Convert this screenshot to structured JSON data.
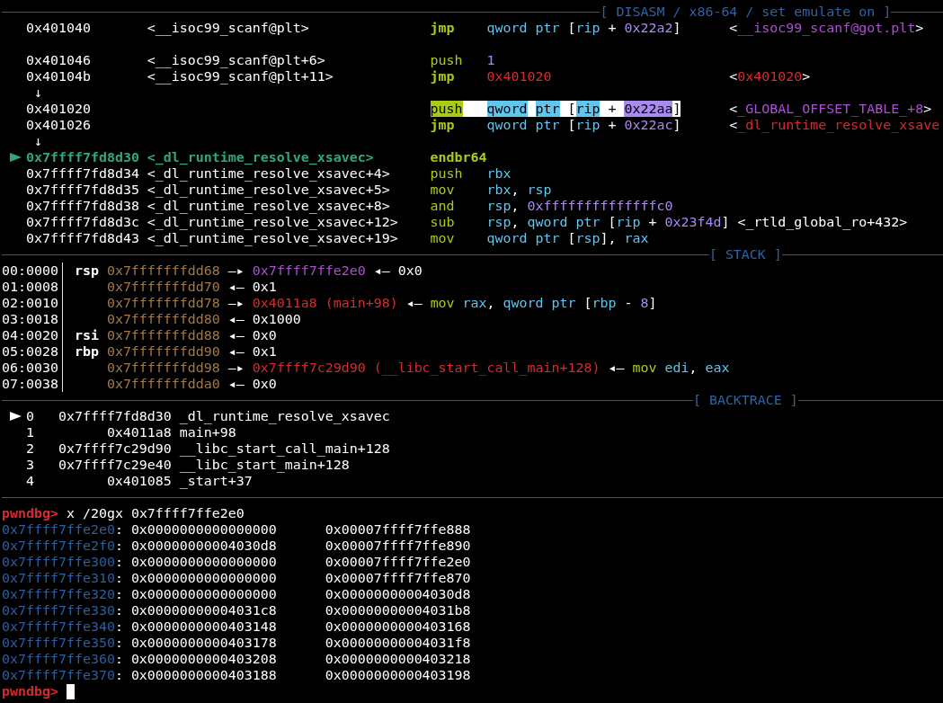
{
  "disasm": {
    "title": "[ DISASM / x86-64 / set emulate on ]",
    "rows": [
      {
        "kind": "instruction",
        "current": false,
        "highlighted": false,
        "branch": true,
        "address": "0x401040",
        "symbol": "<__isoc99_scanf@plt>",
        "mnemonic": "jmp",
        "operands": [
          {
            "text": "qword ptr",
            "kind": "keyword"
          },
          {
            "text": " [",
            "kind": "plain"
          },
          {
            "text": "rip",
            "kind": "register"
          },
          {
            "text": " + ",
            "kind": "plain"
          },
          {
            "text": "0x22a2",
            "kind": "imm"
          },
          {
            "text": "]",
            "kind": "plain"
          }
        ],
        "comment": [
          {
            "text": "<",
            "kind": "plain"
          },
          {
            "text": "__isoc99_scanf@got.plt",
            "kind": "data"
          },
          {
            "text": ">",
            "kind": "plain"
          }
        ]
      },
      {
        "kind": "blank"
      },
      {
        "kind": "instruction",
        "current": false,
        "highlighted": false,
        "branch": false,
        "address": "0x401046",
        "symbol": "<__isoc99_scanf@plt+6>",
        "mnemonic": "push",
        "operands": [
          {
            "text": "1",
            "kind": "imm"
          }
        ]
      },
      {
        "kind": "instruction",
        "current": false,
        "highlighted": false,
        "branch": true,
        "address": "0x40104b",
        "symbol": "<__isoc99_scanf@plt+11>",
        "mnemonic": "jmp",
        "operands": [
          {
            "text": "0x401020",
            "kind": "code"
          }
        ],
        "comment": [
          {
            "text": "<",
            "kind": "plain"
          },
          {
            "text": "0x401020",
            "kind": "code"
          },
          {
            "text": ">",
            "kind": "plain"
          }
        ]
      },
      {
        "kind": "jump",
        "arrow": "↓"
      },
      {
        "kind": "instruction",
        "current": false,
        "highlighted": true,
        "branch": false,
        "address": "0x401020",
        "mnemonic": "push",
        "operands": [
          {
            "text": "qword ptr",
            "kind": "keyword"
          },
          {
            "text": " [",
            "kind": "plain"
          },
          {
            "text": "rip",
            "kind": "register"
          },
          {
            "text": " + ",
            "kind": "plain"
          },
          {
            "text": "0x22aa",
            "kind": "imm"
          },
          {
            "text": "]",
            "kind": "plain"
          }
        ],
        "comment": [
          {
            "text": "<",
            "kind": "plain"
          },
          {
            "text": "_GLOBAL_OFFSET_TABLE_+8",
            "kind": "data"
          },
          {
            "text": ">",
            "kind": "plain"
          }
        ]
      },
      {
        "kind": "instruction",
        "current": false,
        "highlighted": false,
        "branch": true,
        "address": "0x401026",
        "mnemonic": "jmp",
        "operands": [
          {
            "text": "qword ptr",
            "kind": "keyword"
          },
          {
            "text": " [",
            "kind": "plain"
          },
          {
            "text": "rip",
            "kind": "register"
          },
          {
            "text": " + ",
            "kind": "plain"
          },
          {
            "text": "0x22ac",
            "kind": "imm"
          },
          {
            "text": "]",
            "kind": "plain"
          }
        ],
        "comment": [
          {
            "text": "<",
            "kind": "plain"
          },
          {
            "text": "_dl_runtime_resolve_xsave",
            "kind": "code"
          }
        ]
      },
      {
        "kind": "jump",
        "arrow": "↓"
      },
      {
        "kind": "instruction",
        "current": true,
        "highlighted": false,
        "branch": false,
        "address": "0x7ffff7fd8d30",
        "symbol": "<_dl_runtime_resolve_xsavec>",
        "mnemonic": "endbr64"
      },
      {
        "kind": "instruction",
        "current": false,
        "highlighted": false,
        "branch": false,
        "address": "0x7ffff7fd8d34",
        "symbol": "<_dl_runtime_resolve_xsavec+4>",
        "mnemonic": "push",
        "operands": [
          {
            "text": "rbx",
            "kind": "register"
          }
        ]
      },
      {
        "kind": "instruction",
        "current": false,
        "highlighted": false,
        "branch": false,
        "address": "0x7ffff7fd8d35",
        "symbol": "<_dl_runtime_resolve_xsavec+5>",
        "mnemonic": "mov",
        "operands": [
          {
            "text": "rbx",
            "kind": "register"
          },
          {
            "text": ", ",
            "kind": "plain"
          },
          {
            "text": "rsp",
            "kind": "register"
          }
        ]
      },
      {
        "kind": "instruction",
        "current": false,
        "highlighted": false,
        "branch": false,
        "address": "0x7ffff7fd8d38",
        "symbol": "<_dl_runtime_resolve_xsavec+8>",
        "mnemonic": "and",
        "operands": [
          {
            "text": "rsp",
            "kind": "register"
          },
          {
            "text": ", ",
            "kind": "plain"
          },
          {
            "text": "0xffffffffffffffc0",
            "kind": "imm"
          }
        ]
      },
      {
        "kind": "instruction",
        "current": false,
        "highlighted": false,
        "branch": false,
        "address": "0x7ffff7fd8d3c",
        "symbol": "<_dl_runtime_resolve_xsavec+12>",
        "mnemonic": "sub",
        "operands": [
          {
            "text": "rsp",
            "kind": "register"
          },
          {
            "text": ", ",
            "kind": "plain"
          },
          {
            "text": "qword ptr",
            "kind": "keyword"
          },
          {
            "text": " [",
            "kind": "plain"
          },
          {
            "text": "rip",
            "kind": "register"
          },
          {
            "text": " + ",
            "kind": "plain"
          },
          {
            "text": "0x23f4d",
            "kind": "imm"
          },
          {
            "text": "]",
            "kind": "plain"
          }
        ],
        "comment": [
          {
            "text": "<_rtld_global_ro+432>",
            "kind": "plain"
          }
        ]
      },
      {
        "kind": "instruction",
        "current": false,
        "highlighted": false,
        "branch": false,
        "address": "0x7ffff7fd8d43",
        "symbol": "<_dl_runtime_resolve_xsavec+19>",
        "mnemonic": "mov",
        "operands": [
          {
            "text": "qword ptr",
            "kind": "keyword"
          },
          {
            "text": " [",
            "kind": "plain"
          },
          {
            "text": "rsp",
            "kind": "register"
          },
          {
            "text": "], ",
            "kind": "plain"
          },
          {
            "text": "rax",
            "kind": "register"
          }
        ]
      }
    ]
  },
  "stack": {
    "title": "[ STACK ]",
    "rows": [
      {
        "offset": "00:0000",
        "register": "rsp",
        "address": "0x7fffffffdd68",
        "chain": [
          {
            "kind": "arrow",
            "text": "—▸"
          },
          {
            "kind": "data",
            "text": "0x7ffff7ffe2e0"
          },
          {
            "kind": "arrow",
            "text": "◂—"
          },
          {
            "kind": "plain",
            "text": "0x0"
          }
        ]
      },
      {
        "offset": "01:0008",
        "address": "0x7fffffffdd70",
        "chain": [
          {
            "kind": "arrow",
            "text": "◂—"
          },
          {
            "kind": "plain",
            "text": "0x1"
          }
        ]
      },
      {
        "offset": "02:0010",
        "address": "0x7fffffffdd78",
        "chain": [
          {
            "kind": "arrow",
            "text": "—▸"
          },
          {
            "kind": "code",
            "text": "0x4011a8 (main+98)"
          },
          {
            "kind": "arrow",
            "text": "◂—"
          },
          {
            "kind": "instruction",
            "mnemonic": "mov",
            "operands": [
              {
                "text": "rax",
                "kind": "register"
              },
              {
                "text": ", ",
                "kind": "plain"
              },
              {
                "text": "qword ptr",
                "kind": "keyword"
              },
              {
                "text": " [",
                "kind": "plain"
              },
              {
                "text": "rbp",
                "kind": "register"
              },
              {
                "text": " - ",
                "kind": "plain"
              },
              {
                "text": "8",
                "kind": "imm"
              },
              {
                "text": "]",
                "kind": "plain"
              }
            ]
          }
        ]
      },
      {
        "offset": "03:0018",
        "address": "0x7fffffffdd80",
        "chain": [
          {
            "kind": "arrow",
            "text": "◂—"
          },
          {
            "kind": "plain",
            "text": "0x1000"
          }
        ]
      },
      {
        "offset": "04:0020",
        "register": "rsi",
        "address": "0x7fffffffdd88",
        "chain": [
          {
            "kind": "arrow",
            "text": "◂—"
          },
          {
            "kind": "plain",
            "text": "0x0"
          }
        ]
      },
      {
        "offset": "05:0028",
        "register": "rbp",
        "address": "0x7fffffffdd90",
        "chain": [
          {
            "kind": "arrow",
            "text": "◂—"
          },
          {
            "kind": "plain",
            "text": "0x1"
          }
        ]
      },
      {
        "offset": "06:0030",
        "address": "0x7fffffffdd98",
        "chain": [
          {
            "kind": "arrow",
            "text": "—▸"
          },
          {
            "kind": "code",
            "text": "0x7ffff7c29d90 (__libc_start_call_main+128)"
          },
          {
            "kind": "arrow",
            "text": "◂—"
          },
          {
            "kind": "instruction",
            "mnemonic": "mov",
            "operands": [
              {
                "text": "edi",
                "kind": "register"
              },
              {
                "text": ", ",
                "kind": "plain"
              },
              {
                "text": "eax",
                "kind": "register"
              }
            ]
          }
        ]
      },
      {
        "offset": "07:0038",
        "address": "0x7fffffffdda0",
        "chain": [
          {
            "kind": "arrow",
            "text": "◂—"
          },
          {
            "kind": "plain",
            "text": "0x0"
          }
        ]
      }
    ]
  },
  "backtrace": {
    "title": "[ BACKTRACE ]",
    "frames": [
      {
        "current": true,
        "index": "0",
        "address": "0x7ffff7fd8d30",
        "function": "_dl_runtime_resolve_xsavec"
      },
      {
        "current": false,
        "index": "1",
        "address": "0x4011a8",
        "function": "main+98"
      },
      {
        "current": false,
        "index": "2",
        "address": "0x7ffff7c29d90",
        "function": "__libc_start_call_main+128"
      },
      {
        "current": false,
        "index": "3",
        "address": "0x7ffff7c29e40",
        "function": "__libc_start_main+128"
      },
      {
        "current": false,
        "index": "4",
        "address": "0x401085",
        "function": "_start+37"
      }
    ]
  },
  "console": {
    "command": {
      "prompt": "pwndbg>",
      "input": "x /20gx 0x7ffff7ffe2e0"
    },
    "dump": [
      {
        "address": "0x7ffff7ffe2e0",
        "separator": ":",
        "values": [
          "0x0000000000000000",
          "0x00007ffff7ffe888"
        ]
      },
      {
        "address": "0x7ffff7ffe2f0",
        "separator": ":",
        "values": [
          "0x00000000004030d8",
          "0x00007ffff7ffe890"
        ]
      },
      {
        "address": "0x7ffff7ffe300",
        "separator": ":",
        "values": [
          "0x0000000000000000",
          "0x00007ffff7ffe2e0"
        ]
      },
      {
        "address": "0x7ffff7ffe310",
        "separator": ":",
        "values": [
          "0x0000000000000000",
          "0x00007ffff7ffe870"
        ]
      },
      {
        "address": "0x7ffff7ffe320",
        "separator": ":",
        "values": [
          "0x0000000000000000",
          "0x00000000004030d8"
        ]
      },
      {
        "address": "0x7ffff7ffe330",
        "separator": ":",
        "values": [
          "0x00000000004031c8",
          "0x00000000004031b8"
        ]
      },
      {
        "address": "0x7ffff7ffe340",
        "separator": ":",
        "values": [
          "0x0000000000403148",
          "0x0000000000403168"
        ]
      },
      {
        "address": "0x7ffff7ffe350",
        "separator": ":",
        "values": [
          "0x0000000000403178",
          "0x00000000004031f8"
        ]
      },
      {
        "address": "0x7ffff7ffe360",
        "separator": ":",
        "values": [
          "0x0000000000403208",
          "0x0000000000403218"
        ]
      },
      {
        "address": "0x7ffff7ffe370",
        "separator": ":",
        "values": [
          "0x0000000000403188",
          "0x0000000000403198"
        ]
      }
    ],
    "prompt": "pwndbg>"
  }
}
